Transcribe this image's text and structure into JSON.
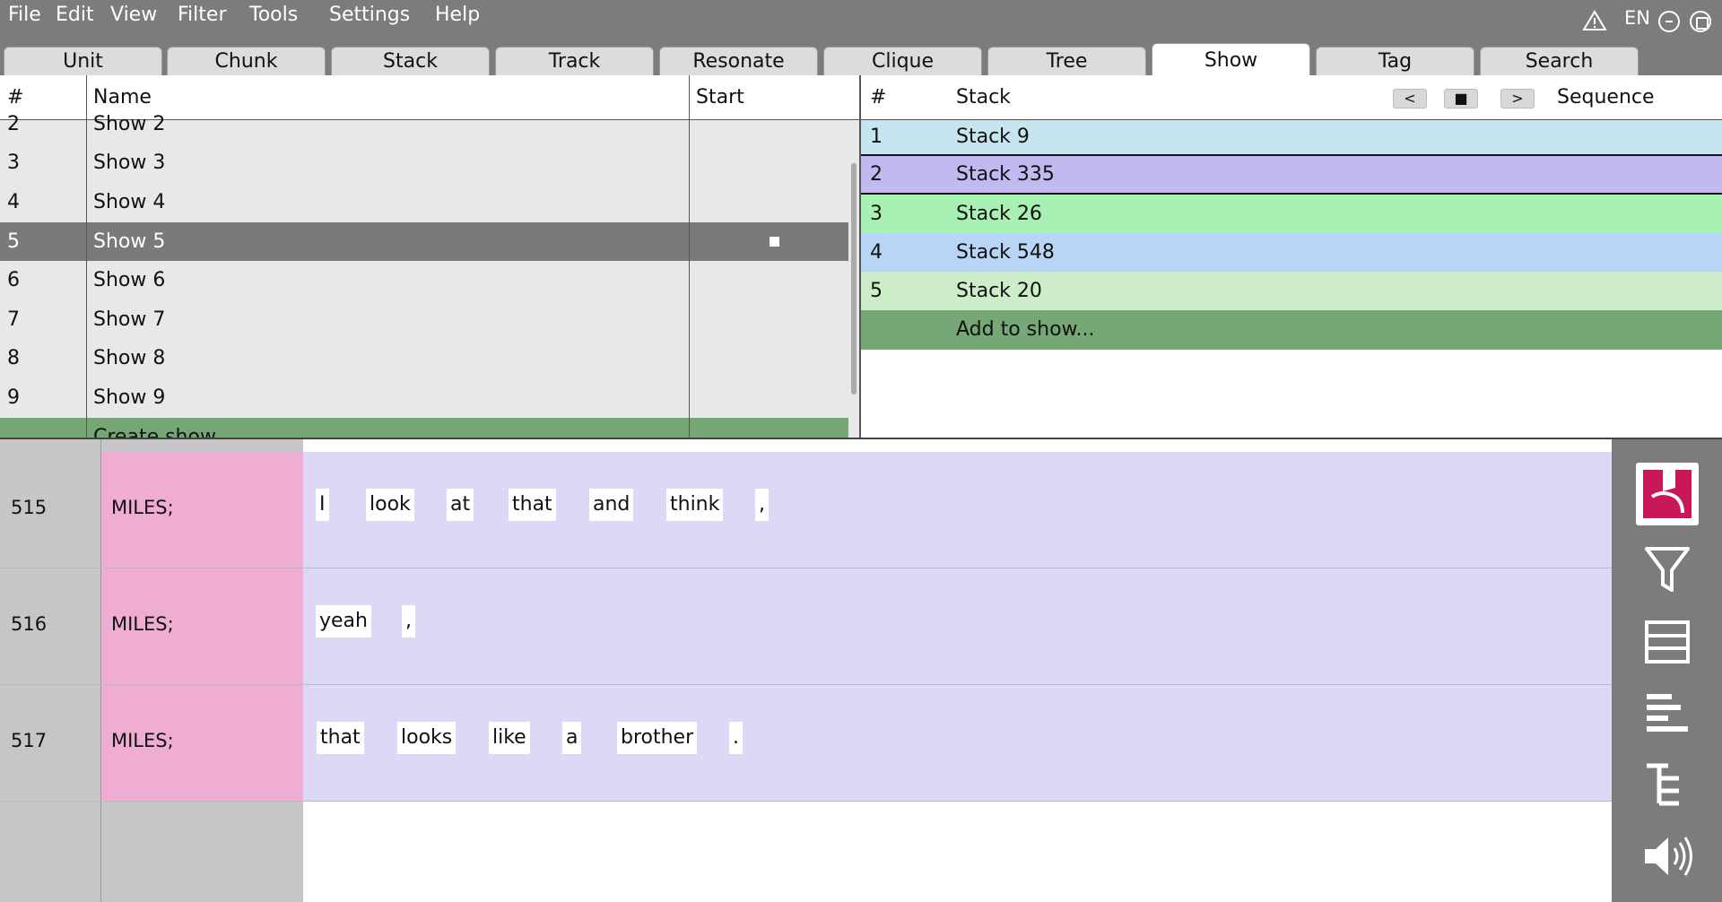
{
  "menu": [
    "File",
    "Edit",
    "View",
    "Filter",
    "Tools",
    "Settings",
    "Help"
  ],
  "status": {
    "language": "EN"
  },
  "tabs": [
    "Unit",
    "Chunk",
    "Stack",
    "Track",
    "Resonate",
    "Clique",
    "Tree",
    "Show",
    "Tag",
    "Search"
  ],
  "active_tab": "Show",
  "shows_panel": {
    "headers": {
      "num": "#",
      "name": "Name",
      "start": "Start"
    },
    "rows": [
      {
        "num": "2",
        "name": "Show 2"
      },
      {
        "num": "3",
        "name": "Show 3"
      },
      {
        "num": "4",
        "name": "Show 4"
      },
      {
        "num": "5",
        "name": "Show 5"
      },
      {
        "num": "6",
        "name": "Show 6"
      },
      {
        "num": "7",
        "name": "Show 7"
      },
      {
        "num": "8",
        "name": "Show 8"
      },
      {
        "num": "9",
        "name": "Show 9"
      }
    ],
    "selected": "5",
    "create_label": "Create show..."
  },
  "stacks_panel": {
    "headers": {
      "num": "#",
      "stack": "Stack",
      "sequence": "Sequence"
    },
    "nav": {
      "prev": "<",
      "stop": "■",
      "next": ">"
    },
    "rows": [
      {
        "num": "1",
        "name": "Stack 9",
        "color": "#c5e6ee"
      },
      {
        "num": "2",
        "name": "Stack 335",
        "color": "#c3b8ef"
      },
      {
        "num": "3",
        "name": "Stack 26",
        "color": "#a8f0b3"
      },
      {
        "num": "4",
        "name": "Stack 548",
        "color": "#b8d5f5"
      },
      {
        "num": "5",
        "name": "Stack 20",
        "color": "#cdedc9"
      }
    ],
    "add_label": "Add to show..."
  },
  "transcript": [
    {
      "num": "515",
      "speaker": "MILES;",
      "words": [
        "I",
        "look",
        "at",
        "that",
        "and",
        "think",
        ","
      ]
    },
    {
      "num": "516",
      "speaker": "MILES;",
      "words": [
        "yeah",
        ","
      ]
    },
    {
      "num": "517",
      "speaker": "MILES;",
      "words": [
        "that",
        "looks",
        "like",
        "a",
        "brother",
        "."
      ]
    }
  ],
  "sidebar": [
    "logo-icon",
    "filter-icon",
    "rows-icon",
    "align-left-icon",
    "tree-icon",
    "speaker-icon"
  ],
  "colors": {
    "chrome": "#7c7c7c",
    "speaker": "#efadd4",
    "line_bg": "#dcd8f6",
    "create_row": "#74a774",
    "add_row": "#75a876",
    "logo": "#c8185a"
  }
}
